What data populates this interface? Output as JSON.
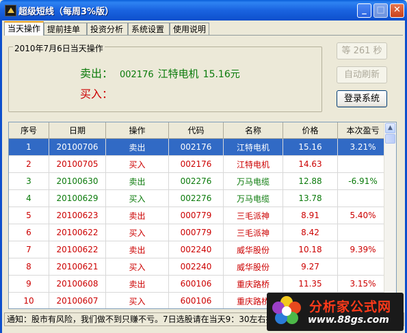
{
  "window": {
    "title": "超级短线（每周3%版）",
    "min_glyph": "_",
    "max_glyph": "□",
    "close_glyph": "✕"
  },
  "tabs": [
    {
      "label": "当天操作"
    },
    {
      "label": "提前挂单"
    },
    {
      "label": "投资分析"
    },
    {
      "label": "系统设置"
    },
    {
      "label": "使用说明"
    }
  ],
  "today": {
    "group_title": "2010年7月6日当天操作",
    "sell_label": "卖出：",
    "sell_code": "002176",
    "sell_name": "江特电机",
    "sell_price": "15.16元",
    "buy_label": "买入："
  },
  "buttons": {
    "countdown": "等 261 秒",
    "auto_refresh": "自动刷新",
    "login": "登录系统"
  },
  "table": {
    "headers": [
      "序号",
      "日期",
      "操作",
      "代码",
      "名称",
      "价格",
      "本次盈亏"
    ],
    "rows": [
      {
        "no": "1",
        "date": "20100706",
        "op": "卖出",
        "code": "002176",
        "name": "江特电机",
        "price": "15.16",
        "pl": "3.21%",
        "type": "sell",
        "selected": true
      },
      {
        "no": "2",
        "date": "20100705",
        "op": "买入",
        "code": "002176",
        "name": "江特电机",
        "price": "14.63",
        "pl": "",
        "type": "buy"
      },
      {
        "no": "3",
        "date": "20100630",
        "op": "卖出",
        "code": "002276",
        "name": "万马电缆",
        "price": "12.88",
        "pl": "-6.91%",
        "type": "sell"
      },
      {
        "no": "4",
        "date": "20100629",
        "op": "买入",
        "code": "002276",
        "name": "万马电缆",
        "price": "13.78",
        "pl": "",
        "type": "sell"
      },
      {
        "no": "5",
        "date": "20100623",
        "op": "卖出",
        "code": "000779",
        "name": "三毛派神",
        "price": "8.91",
        "pl": "5.40%",
        "type": "buy"
      },
      {
        "no": "6",
        "date": "20100622",
        "op": "买入",
        "code": "000779",
        "name": "三毛派神",
        "price": "8.42",
        "pl": "",
        "type": "buy"
      },
      {
        "no": "7",
        "date": "20100622",
        "op": "卖出",
        "code": "002240",
        "name": "威华股份",
        "price": "10.18",
        "pl": "9.39%",
        "type": "buy"
      },
      {
        "no": "8",
        "date": "20100621",
        "op": "买入",
        "code": "002240",
        "name": "威华股份",
        "price": "9.27",
        "pl": "",
        "type": "buy"
      },
      {
        "no": "9",
        "date": "20100608",
        "op": "卖出",
        "code": "600106",
        "name": "重庆路桥",
        "price": "11.35",
        "pl": "3.15%",
        "type": "buy"
      },
      {
        "no": "10",
        "date": "20100607",
        "op": "买入",
        "code": "600106",
        "name": "重庆路桥",
        "price": "",
        "pl": "",
        "type": "buy"
      }
    ]
  },
  "status_text": "通知：股市有风险，我们做不到只赚不亏。7日选股请在当天9：30左右接",
  "watermark": {
    "line1": "分析家公式网",
    "line2": "www.88gs.com"
  },
  "colors": {
    "sell": "#0A7A0A",
    "buy": "#CC0000",
    "selected": "#316AC5"
  }
}
